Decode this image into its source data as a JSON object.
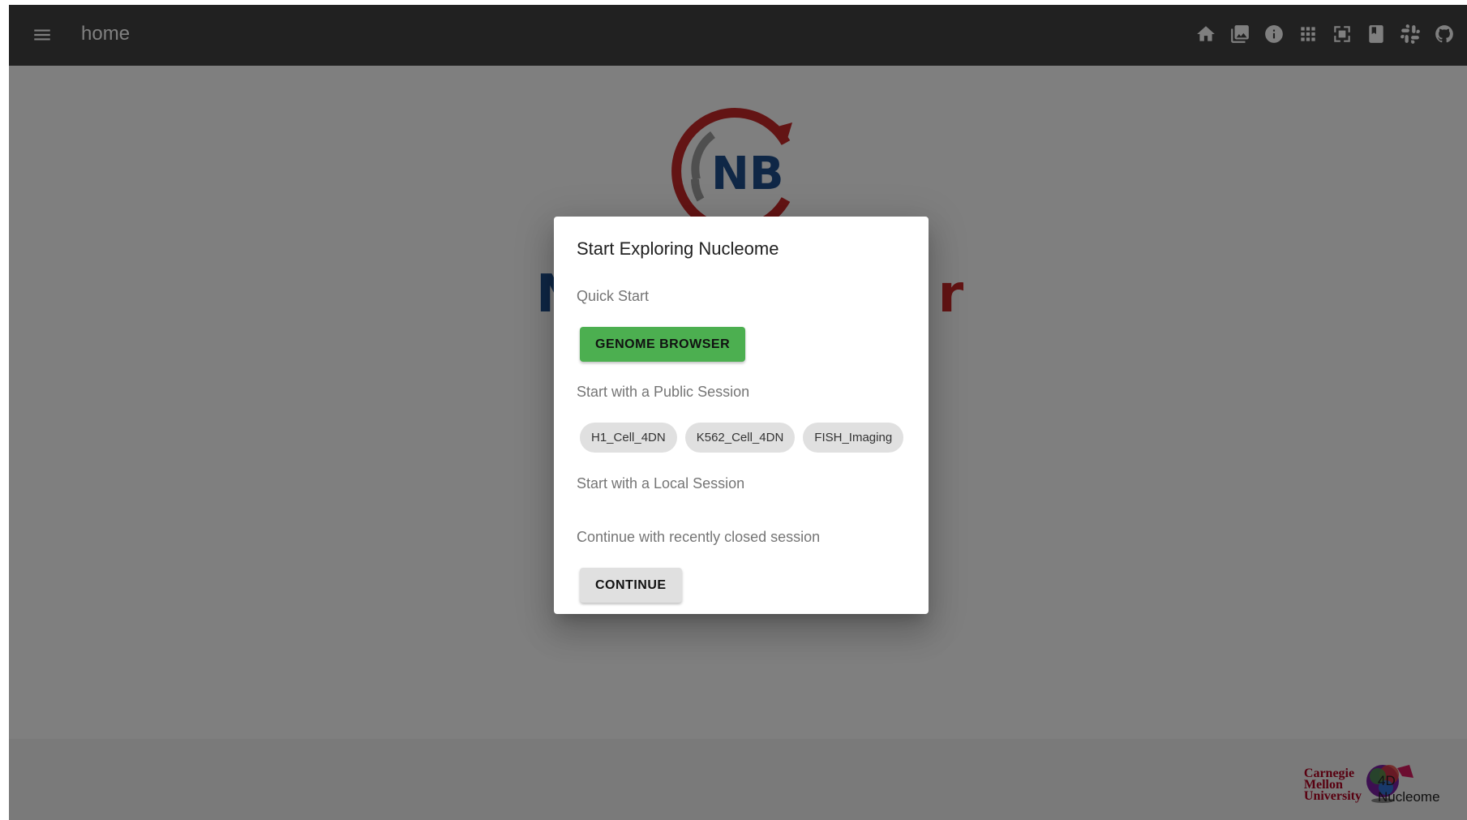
{
  "appbar": {
    "title": "home",
    "icons": [
      "home-icon",
      "image-icon",
      "info-icon",
      "apps-icon",
      "fullscreen-icon",
      "bookmark-icon",
      "slack-icon",
      "github-icon"
    ]
  },
  "background": {
    "logo_text": "NB",
    "headline_left": "N",
    "headline_right": "r"
  },
  "dialog": {
    "title": "Start Exploring Nucleome",
    "quick_start_label": "Quick Start",
    "genome_browser_label": "GENOME BROWSER",
    "public_session_label": "Start with a Public Session",
    "public_sessions": [
      "H1_Cell_4DN",
      "K562_Cell_4DN",
      "FISH_Imaging"
    ],
    "local_session_label": "Start with a Local Session",
    "recent_session_label": "Continue with recently closed session",
    "continue_label": "CONTINUE"
  },
  "footer": {
    "cmu_line1": "Carnegie",
    "cmu_line2": "Mellon",
    "cmu_line3": "University",
    "fdn_logo_text": "4D Nucleome"
  },
  "colors": {
    "appbar": "#424242",
    "primary_button": "#4caf50",
    "chip": "#e0e0e0",
    "logo_blue": "#1f4e8c",
    "logo_red": "#c62828"
  }
}
